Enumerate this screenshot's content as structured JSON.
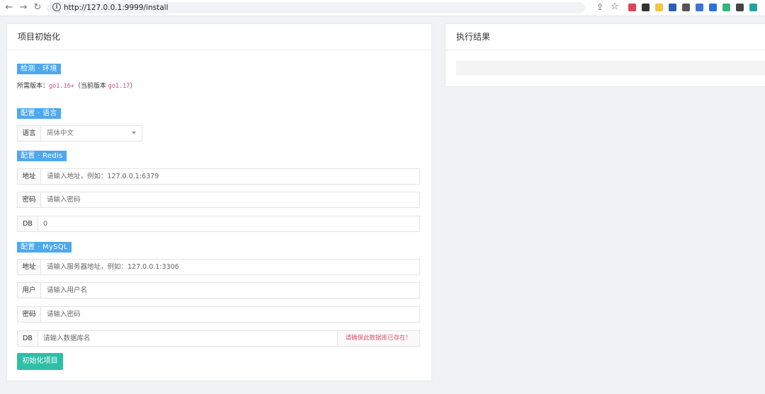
{
  "browser": {
    "url": "http://127.0.0.1:9999/install",
    "back_icon": "←",
    "forward_icon": "→",
    "reload_icon": "↻",
    "info_icon": "i",
    "share_icon": "⇪",
    "star_icon": "☆",
    "extension_colors": [
      "#e0445a",
      "#333333",
      "#f6c343",
      "#2b5fb3",
      "#555555",
      "#3b73d8",
      "#2b6fe8",
      "#36b37e",
      "#444444",
      "#20a3a0"
    ]
  },
  "left_panel": {
    "title": "项目初始化",
    "env": {
      "tag": "检测 · 环境",
      "required_prefix": "所需版本：",
      "required_version": "go1.16+",
      "current_open": "（当前版本 ",
      "current_version": "go1.17",
      "current_close": "）"
    },
    "language": {
      "tag": "配置 · 语言",
      "label": "语言",
      "selected": "简体中文"
    },
    "redis": {
      "tag": "配置 · Redis",
      "address_label": "地址",
      "address_placeholder": "请输入地址，例如：127.0.0.1:6379",
      "password_label": "密码",
      "password_placeholder": "请输入密码",
      "db_label": "DB",
      "db_placeholder": "0"
    },
    "mysql": {
      "tag": "配置 · MySQL",
      "address_label": "地址",
      "address_placeholder": "请输入服务器地址，例如：127.0.0.1:3306",
      "user_label": "用户",
      "user_placeholder": "请输入用户名",
      "password_label": "密码",
      "password_placeholder": "请输入密码",
      "db_label": "DB",
      "db_placeholder": "请输入数据库名",
      "db_hint": "请确保此数据库已存在！"
    },
    "submit_label": "初始化项目"
  },
  "right_panel": {
    "title": "执行结果"
  }
}
